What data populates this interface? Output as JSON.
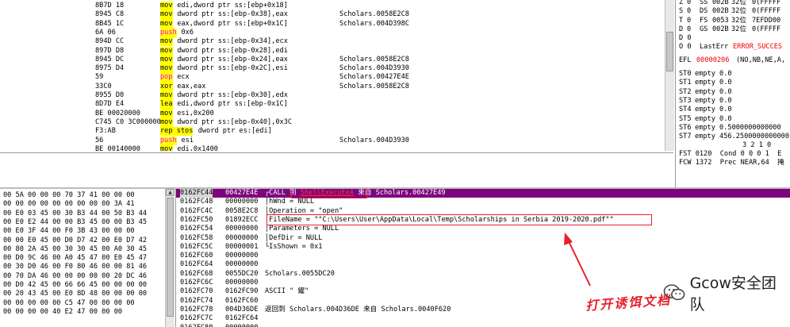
{
  "disasm": {
    "rows": [
      {
        "addr": "",
        "hex": "8B7D 18",
        "mnem": "mov",
        "ops": "edi,dword ptr ss:[ebp+0x18]",
        "comment": ""
      },
      {
        "addr": "",
        "hex": "8945 C8",
        "mnem": "mov",
        "ops": "dword ptr ss:[ebp-0x38],eax",
        "comment": "Scholars.0058E2C8"
      },
      {
        "addr": "",
        "hex": "8B45 1C",
        "mnem": "mov",
        "ops": "eax,dword ptr ss:[ebp+0x1C]",
        "comment": "Scholars.004D398C"
      },
      {
        "addr": "",
        "hex": "6A 06",
        "mnem": "push",
        "ops": "0x6",
        "comment": ""
      },
      {
        "addr": "",
        "hex": "894D CC",
        "mnem": "mov",
        "ops": "dword ptr ss:[ebp-0x34],ecx",
        "comment": ""
      },
      {
        "addr": "",
        "hex": "897D D8",
        "mnem": "mov",
        "ops": "dword ptr ss:[ebp-0x28],edi",
        "comment": ""
      },
      {
        "addr": "",
        "hex": "8945 DC",
        "mnem": "mov",
        "ops": "dword ptr ss:[ebp-0x24],eax",
        "comment": "Scholars.0058E2C8"
      },
      {
        "addr": "",
        "hex": "8975 D4",
        "mnem": "mov",
        "ops": "dword ptr ss:[ebp-0x2C],esi",
        "comment": "Scholars.004D3930"
      },
      {
        "addr": "",
        "hex": "59",
        "mnem": "pop",
        "ops": "ecx",
        "comment": "Scholars.00427E4E"
      },
      {
        "addr": "",
        "hex": "33C0",
        "mnem": "xor",
        "ops": "eax,eax",
        "comment": "Scholars.0058E2C8"
      },
      {
        "addr": "",
        "hex": "8955 D0",
        "mnem": "mov",
        "ops": "dword ptr ss:[ebp-0x30],edx",
        "comment": ""
      },
      {
        "addr": "",
        "hex": "8D7D E4",
        "mnem": "lea",
        "ops": "edi,dword ptr ss:[ebp-0x1C]",
        "comment": ""
      },
      {
        "addr": "",
        "hex": "BE 00020000",
        "mnem": "mov",
        "ops": "esi,0x200",
        "comment": ""
      },
      {
        "addr": "",
        "hex": "C745 C0 3C000000",
        "mnem": "mov",
        "ops": "dword ptr ss:[ebp-0x40],0x3C",
        "comment": ""
      },
      {
        "addr": "",
        "hex": "F3:AB",
        "mnem": "rep stos",
        "ops": "dword ptr es:[edi]",
        "comment": ""
      },
      {
        "addr": "",
        "hex": "56",
        "mnem": "push",
        "ops": "esi",
        "comment": "Scholars.004D3930"
      },
      {
        "addr": "",
        "hex": "BE 00140000",
        "mnem": "mov",
        "ops": "edi,0x1400",
        "comment": ""
      }
    ]
  },
  "registers": {
    "segs": [
      {
        "flag": "Z",
        "v": "0",
        "seg": "SS",
        "sel": "002B",
        "bits": "32位",
        "base": "0(FFFFF"
      },
      {
        "flag": "S",
        "v": "0",
        "seg": "DS",
        "sel": "002B",
        "bits": "32位",
        "base": "0(FFFFF"
      },
      {
        "flag": "T",
        "v": "0",
        "seg": "FS",
        "sel": "0053",
        "bits": "32位",
        "base": "7EFDD00"
      },
      {
        "flag": "D",
        "v": "0",
        "seg": "GS",
        "sel": "002B",
        "bits": "32位",
        "base": "0(FFFFF"
      }
    ],
    "d_flag": "D 0",
    "o_flag": "O 0",
    "lasterr_label": "LastErr",
    "lasterr_value": "ERROR_SUCCES",
    "efl_label": "EFL",
    "efl_value": "00000206",
    "efl_flags": "(NO,NB,NE,A,",
    "fpu": [
      {
        "name": "ST0",
        "v": "empty 0.0"
      },
      {
        "name": "ST1",
        "v": "empty 0.0"
      },
      {
        "name": "ST2",
        "v": "empty 0.0"
      },
      {
        "name": "ST3",
        "v": "empty 0.0"
      },
      {
        "name": "ST4",
        "v": "empty 0.0"
      },
      {
        "name": "ST5",
        "v": "empty 0.0"
      },
      {
        "name": "ST6",
        "v": "empty 0.5000000000000"
      },
      {
        "name": "ST7",
        "v": "empty 456.2500000000000"
      }
    ],
    "fpu_bits_header": "3 2 1 0",
    "fst": "FST 0120  Cond 0 0 0 1  E",
    "fcw": "FCW 1372  Prec NEAR,64  掩"
  },
  "dump": {
    "rows": [
      "00 5A 00 00 00 70 37 41 00 00 00",
      "00 00 00 00 00 00 00 00 00 3A 41",
      "00 E0 03 45 00 30 B3 44 00 50 B3 44",
      "00 E0 E2 44 00 00 B3 45 00 00 B3 45",
      "00 E0 3F 44 00 F0 3B 43 00 00 00",
      "00 00 E0 45 00 D0 D7 42 00 E0 D7 42",
      "00 80 2A 45 00 30 30 45 00 A0 30 45",
      "00 D0 9C 46 00 A0 45 47 00 E0 45 47",
      "00 30 D0 46 00 F0 80 46 00 00 81 46",
      "00 70 DA 46 00 00 00 00 00 20 DC 46",
      "00 D0 42 45 00 66 66 45 00 00 00 00",
      "00 20 43 45 00 E0 8D 48 00 00 00 00",
      "00 00 00 00 00 C5 47 00 00 00 00",
      "00 00 00 00 40 E2 47 00 00 00"
    ]
  },
  "stack": {
    "rows": [
      {
        "addr": "0162FC44",
        "val": "00427E4E",
        "cmt_pre": "┌CALL 到 ",
        "cmt_call": "ShellExecuteA",
        "cmt_post": " 来自 Scholars.00427E49"
      },
      {
        "addr": "0162FC48",
        "val": "00000000",
        "cmt": "│hWnd = NULL"
      },
      {
        "addr": "0162FC4C",
        "val": "0058E2C8",
        "cmt": "│Operation = \"open\""
      },
      {
        "addr": "0162FC50",
        "val": "01892ECC",
        "cmt": "│FileName = \"\"C:\\Users\\User\\AppData\\Local\\Temp\\Scholarships in Serbia 2019-2020.pdf\"\""
      },
      {
        "addr": "0162FC54",
        "val": "00000000",
        "cmt": "│Parameters = NULL"
      },
      {
        "addr": "0162FC58",
        "val": "00000000",
        "cmt": "│DefDir = NULL"
      },
      {
        "addr": "0162FC5C",
        "val": "00000001",
        "cmt": "└IsShown = 0x1"
      },
      {
        "addr": "0162FC60",
        "val": "00000000",
        "cmt": ""
      },
      {
        "addr": "0162FC64",
        "val": "00000000",
        "cmt": ""
      },
      {
        "addr": "0162FC68",
        "val": "0055DC20",
        "cmt": "Scholars.0055DC20"
      },
      {
        "addr": "0162FC6C",
        "val": "00000000",
        "cmt": ""
      },
      {
        "addr": "0162FC70",
        "val": "0162FC90",
        "cmt": "ASCII \" 鑃\""
      },
      {
        "addr": "0162FC74",
        "val": "0162FC60",
        "cmt": ""
      },
      {
        "addr": "0162FC78",
        "val": "004D36DE",
        "cmt": "返回到 Scholars.004D36DE 来自 Scholars.0040F620"
      },
      {
        "addr": "0162FC7C",
        "val": "0162FC64",
        "cmt": ""
      },
      {
        "addr": "0162FC80",
        "val": "00000000",
        "cmt": ""
      }
    ]
  },
  "annotation": {
    "label": "打开诱饵文档"
  },
  "watermark": {
    "text": "Gcow安全团队"
  }
}
